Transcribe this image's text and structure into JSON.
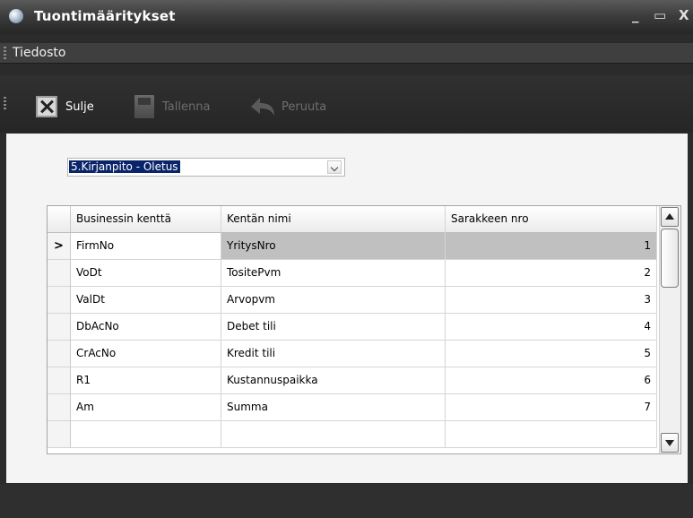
{
  "window": {
    "title": "Tuontimääritykset",
    "minimize_label": "_",
    "maximize_label": "▭",
    "close_label": "X"
  },
  "menu": {
    "items": [
      {
        "label": "Tiedosto"
      }
    ]
  },
  "toolbar": {
    "close_label": "Sulje",
    "save_label": "Tallenna",
    "undo_label": "Peruuta"
  },
  "combo": {
    "selected": "5.Kirjanpito - Oletus"
  },
  "grid": {
    "columns": [
      "Businessin kenttä",
      "Kentän nimi",
      "Sarakkeen nro"
    ],
    "current_row_marker": ">",
    "rows": [
      {
        "field": "FirmNo",
        "name": "YritysNro",
        "col": "1"
      },
      {
        "field": "VoDt",
        "name": "TositePvm",
        "col": "2"
      },
      {
        "field": "ValDt",
        "name": "Arvopvm",
        "col": "3"
      },
      {
        "field": "DbAcNo",
        "name": "Debet tili",
        "col": "4"
      },
      {
        "field": "CrAcNo",
        "name": "Kredit tili",
        "col": "5"
      },
      {
        "field": "R1",
        "name": "Kustannuspaikka",
        "col": "6"
      },
      {
        "field": "Am",
        "name": "Summa",
        "col": "7"
      }
    ]
  },
  "colors": {
    "title_bar": "#3d3d3d",
    "panel": "#f4f4f4",
    "selection": "#0a246a",
    "current_row": "#c0c0c0"
  }
}
